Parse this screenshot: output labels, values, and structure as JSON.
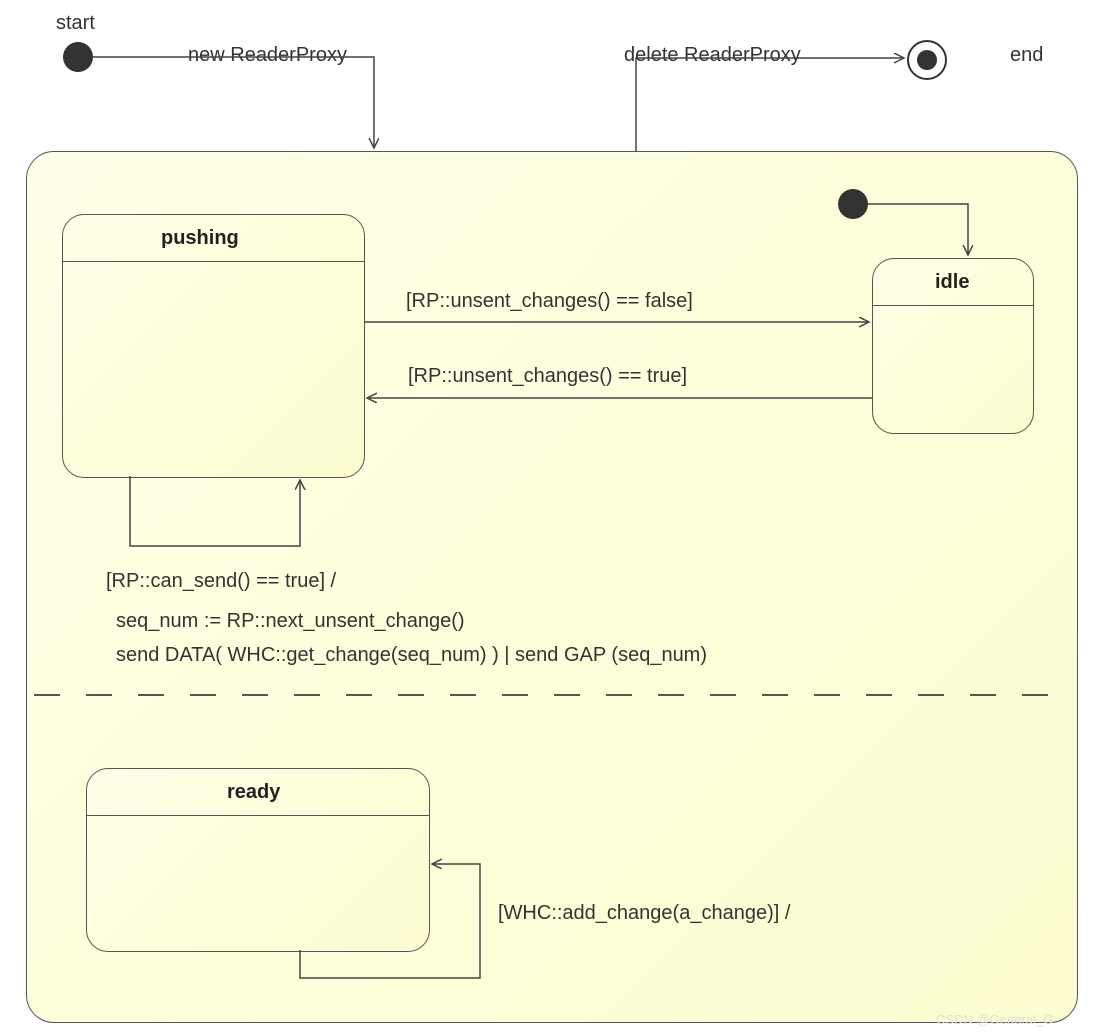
{
  "labels": {
    "start": "start",
    "end": "end",
    "new_reader_proxy": "new ReaderProxy",
    "delete_reader_proxy": "delete ReaderProxy"
  },
  "states": {
    "pushing": "pushing",
    "idle": "idle",
    "ready": "ready"
  },
  "transitions": {
    "pushing_to_idle": "[RP::unsent_changes() == false]",
    "idle_to_pushing": "[RP::unsent_changes() == true]",
    "pushing_self_guard": "[RP::can_send() == true] /",
    "pushing_self_action1": "seq_num := RP::next_unsent_change()",
    "pushing_self_action2": "send DATA( WHC::get_change(seq_num) )  |  send GAP (seq_num)",
    "ready_self": "[WHC::add_change(a_change)] /"
  },
  "watermark": "CSDN @General_G"
}
